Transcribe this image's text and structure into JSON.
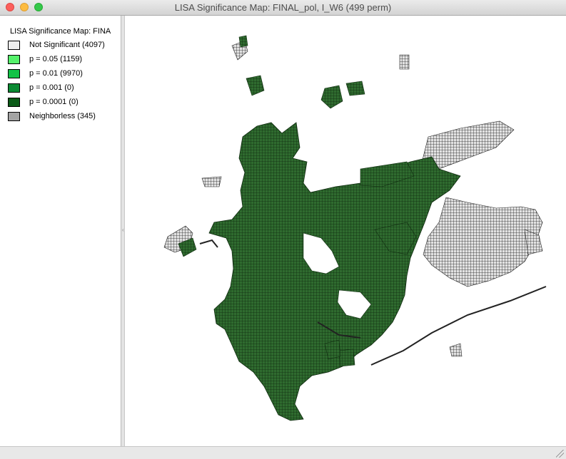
{
  "window": {
    "title": "LISA Significance Map: FINAL_pol, I_W6 (499 perm)"
  },
  "legend": {
    "title": "LISA Significance Map: FINA",
    "items": [
      {
        "label": "Not Significant (4097)",
        "color": "#eeeeee"
      },
      {
        "label": "p = 0.05 (1159)",
        "color": "#55f26b"
      },
      {
        "label": "p = 0.01 (9970)",
        "color": "#12c246"
      },
      {
        "label": "p = 0.001 (0)",
        "color": "#0b8a32"
      },
      {
        "label": "p = 0.0001 (0)",
        "color": "#0a5a17"
      },
      {
        "label": "Neighborless (345)",
        "color": "#a3a3a3"
      }
    ]
  },
  "map": {
    "significant_color": "#2f6b2f",
    "neutral_color": "#d9d9d9",
    "outline_color": "#1a1a1a"
  }
}
